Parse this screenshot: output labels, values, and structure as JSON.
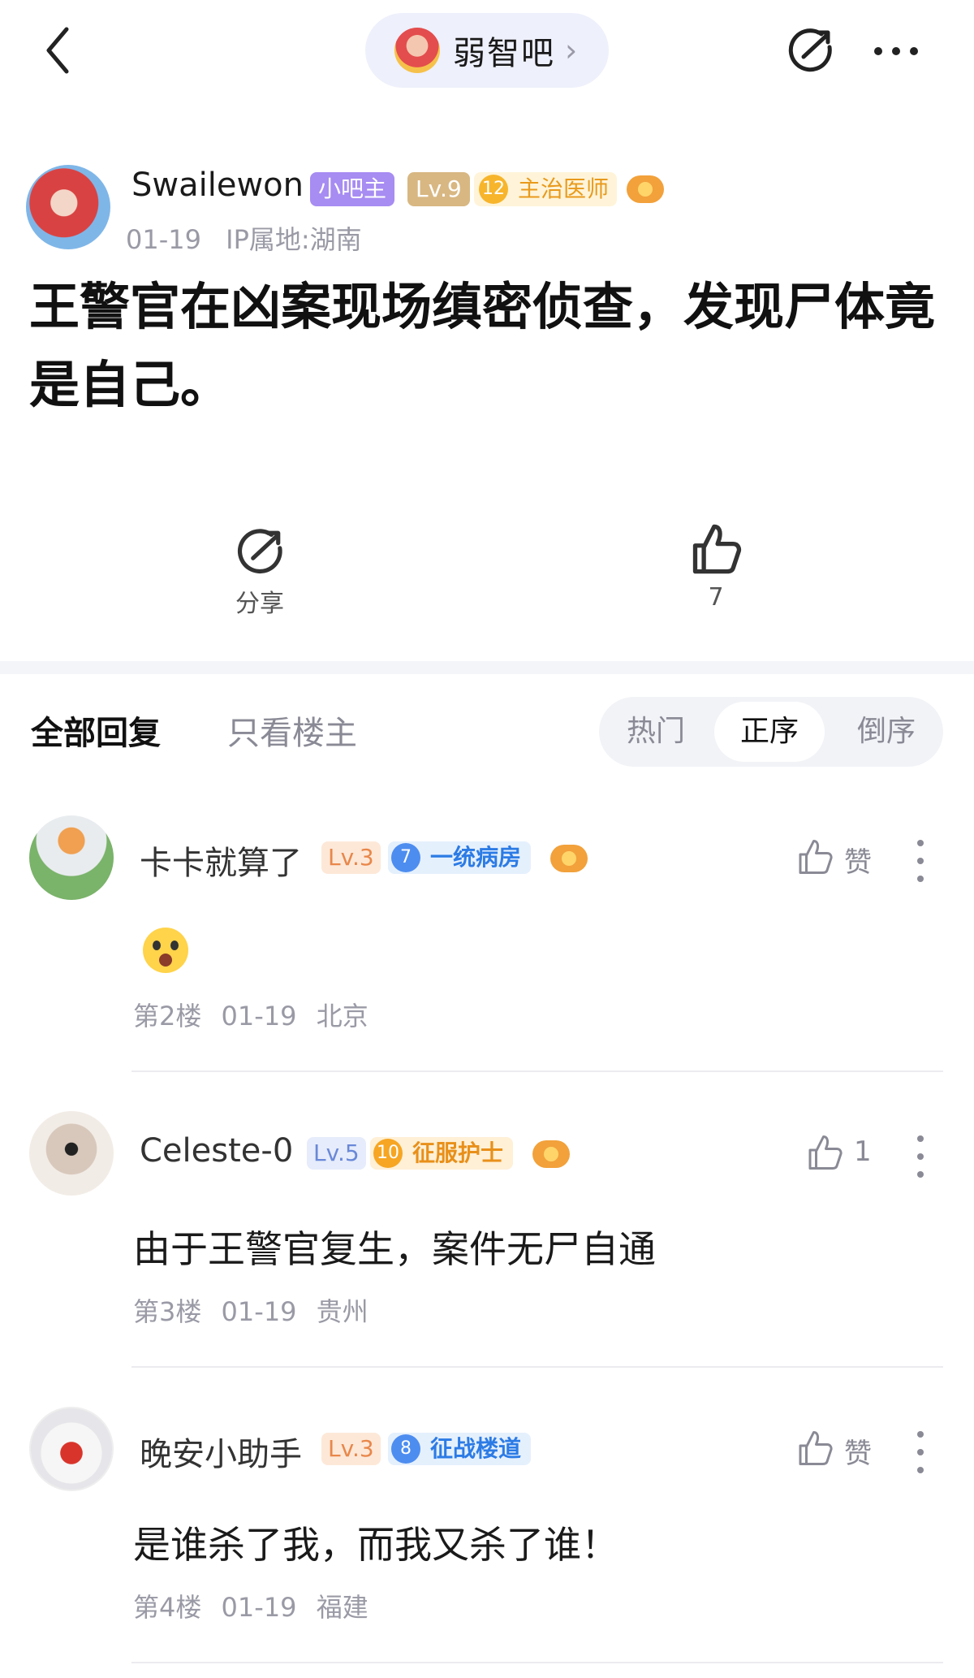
{
  "header": {
    "forum_name": "弱智吧",
    "forum_chevron": "›"
  },
  "post": {
    "author": "Swailewon",
    "mod_badge": "小吧主",
    "level": "Lv.9",
    "title_badge_num": "12",
    "title_badge": "主治医师",
    "date": "01-19",
    "ip": "IP属地:湖南",
    "title": "王警官在凶案现场缜密侦查，发现尸体竟是自己。",
    "share_label": "分享",
    "like_count": "7"
  },
  "tabs": {
    "all": "全部回复",
    "op_only": "只看楼主",
    "sort_hot": "热门",
    "sort_asc": "正序",
    "sort_desc": "倒序"
  },
  "replies": [
    {
      "name": "卡卡就算了",
      "level": "Lv.3",
      "title_num": "7",
      "title": "一统病房",
      "like_label": "赞",
      "body": "",
      "emoji": "screaming-face",
      "floor": "第2楼",
      "date": "01-19",
      "location": "北京"
    },
    {
      "name": "Celeste-0",
      "level": "Lv.5",
      "title_num": "10",
      "title": "征服护士",
      "like_label": "1",
      "body": "由于王警官复生，案件无尸自通",
      "floor": "第3楼",
      "date": "01-19",
      "location": "贵州"
    },
    {
      "name": "晚安小助手",
      "level": "Lv.3",
      "title_num": "8",
      "title": "征战楼道",
      "like_label": "赞",
      "body": "是谁杀了我，而我又杀了谁！",
      "floor": "第4楼",
      "date": "01-19",
      "location": "福建"
    }
  ]
}
